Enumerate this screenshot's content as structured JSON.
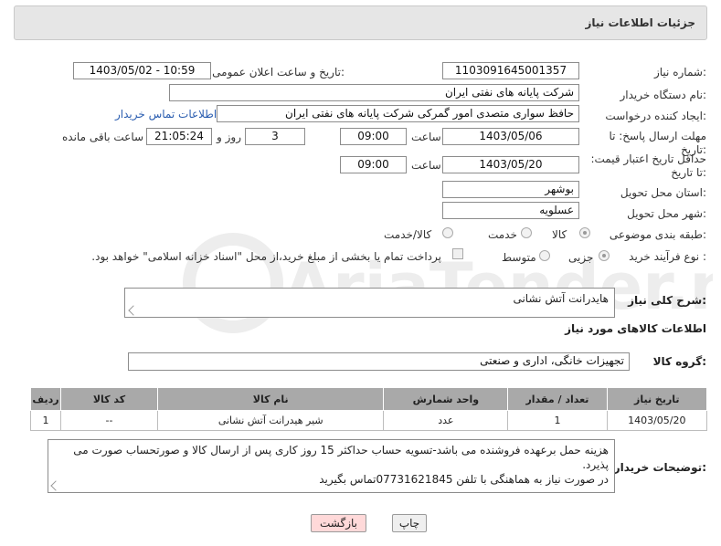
{
  "header": {
    "title": "جزئیات اطلاعات نیاز"
  },
  "labels": {
    "need_number": "شماره نیاز:",
    "announce_datetime": "تاریخ و ساعت اعلان عمومی:",
    "buyer_org": "نام دستگاه خریدار:",
    "requester": "ایجاد کننده درخواست:",
    "buyer_contact": "اطلاعات تماس خریدار",
    "reply_deadline": "مهلت ارسال پاسخ: تا تاریخ:",
    "time": "ساعت",
    "day_and": "روز و",
    "remaining": "ساعت باقی مانده",
    "price_validity": "حداقل تاریخ اعتبار قیمت: تا تاریخ:",
    "province": "استان محل تحویل:",
    "city": "شهر محل تحویل:",
    "category": "طبقه بندی موضوعی:",
    "purchase_type": "نوع فرآیند خرید :",
    "general_desc": "شرح کلی نیاز:",
    "goods_info": "اطلاعات کالاهای مورد نیاز",
    "goods_group": "گروه کالا:",
    "buyer_notes": "توضیحات خریدار:"
  },
  "fields": {
    "need_number": "1103091645001357",
    "announce_datetime": "1403/05/02 - 10:59",
    "buyer_org": "شرکت پایانه های نفتی ایران",
    "requester": "حافظ سواری متصدی امور گمرکی شرکت پایانه های نفتی ایران",
    "reply_date": "1403/05/06",
    "reply_time": "09:00",
    "reply_days": "3",
    "reply_remaining": "21:05:24",
    "validity_date": "1403/05/20",
    "validity_time": "09:00",
    "province": "بوشهر",
    "city": "عسلویه",
    "general_desc": "هایدرانت آتش نشانی",
    "goods_group": "تجهیزات خانگی، اداری و صنعتی",
    "buyer_notes_line1": "هزینه حمل برعهده فروشنده می باشد-تسویه حساب حداکثر 15 روز کاری پس از ارسال کالا و صورتحساب صورت می پذیرد.",
    "buyer_notes_line2": "در صورت نیاز به هماهنگی با تلفن 07731621845تماس بگیرید"
  },
  "category_options": {
    "goods": "کالا",
    "service": "خدمت",
    "goods_service": "کالا/خدمت",
    "selected": "goods"
  },
  "purchase_options": {
    "minor": "جزیی",
    "medium": "متوسط",
    "selected": "minor"
  },
  "payment_note": "پرداخت تمام یا بخشی از مبلغ خرید،از محل \"اسناد خزانه اسلامی\" خواهد بود.",
  "table": {
    "headers": [
      "ردیف",
      "کد کالا",
      "نام کالا",
      "واحد شمارش",
      "تعداد / مقدار",
      "تاریخ نیاز"
    ],
    "rows": [
      [
        "1",
        "--",
        "شیر هیدرانت آتش نشانی",
        "عدد",
        "1",
        "1403/05/20"
      ]
    ]
  },
  "buttons": {
    "print": "چاپ",
    "back": "بازگشت"
  },
  "watermark": {
    "text": "AriaTender.net"
  },
  "colors": {
    "header_bg": "#e6e6e6",
    "table_header": "#a9a9a9",
    "back_button": "#ffd9d9",
    "link": "#2a5db0"
  }
}
